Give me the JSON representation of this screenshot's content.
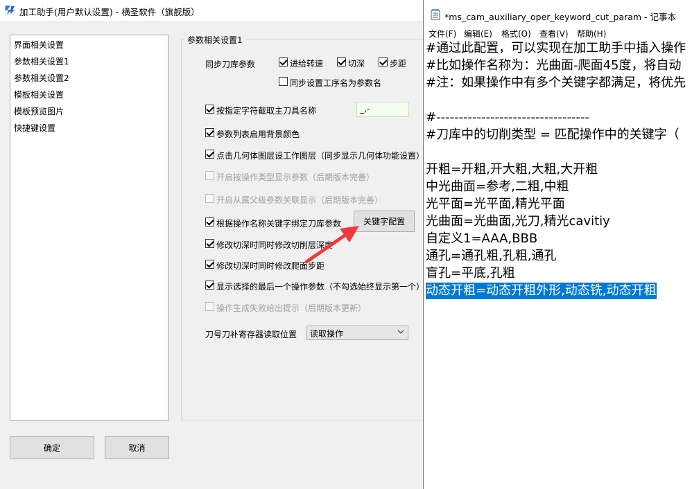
{
  "dialog": {
    "title": "加工助手(用户默认设置) - 横圣软件（旗舰版）",
    "nav_items": [
      "界面相关设置",
      "参数相关设置1",
      "参数相关设置2",
      "模板相关设置",
      "模板预览图片",
      "快捷键设置"
    ],
    "group_title": "参数相关设置1",
    "sync_label": "同步刀库参数",
    "sync_options": {
      "feed": "进给转速",
      "depth": "切深",
      "step": "步距",
      "sync_name": "同步设置工序名为参数名"
    },
    "options": {
      "cut_tool_name": "按指定字符截取主刀具名称",
      "cut_char": "_,-",
      "bg_color": "参数列表启用背景颜色",
      "geom_layer": "点击几何体图层设工作图层（同步显示几何体功能设置）",
      "by_type": "开启按操作类型显示参数（后期版本完善）",
      "parent_link": "开启从属父级参数关联显示（后期版本完善）",
      "bind_keyword": "根据操作名称关键字绑定刀库参数",
      "keyword_button": "关键字配置",
      "cut_depth": "修改切深时同时修改切削层深度",
      "climb_step": "修改切深时同时修改爬面步距",
      "show_last": "显示选择的最后一个操作参数（不勾选始终显示第一个）",
      "fail_prompt": "操作生成失败给出提示（后期版本更新）"
    },
    "register_label": "刀号刀补寄存器读取位置",
    "register_value": "读取操作",
    "ok_button": "确定",
    "cancel_button": "取消"
  },
  "notepad": {
    "title": "*ms_cam_auxiliary_oper_keyword_cut_param - 记事本",
    "menus": [
      "文件(F)",
      "编辑(E)",
      "格式(O)",
      "查看(V)",
      "帮助(H)"
    ],
    "lines": [
      "#通过此配置，可以实现在加工助手中插入操作",
      "#比如操作名称为：光曲面-爬面45度，将自动",
      "#注：如果操作中有多个关键字都满足，将优先",
      "",
      "#----------------------------------",
      "#刀库中的切削类型 = 匹配操作中的关键字（",
      "",
      "开粗=开粗,开大粗,大粗,大开粗",
      "中光曲面=参考,二粗,中粗",
      "光平面=光平面,精光平面",
      "光曲面=光曲面,光刀,精光cavitiy",
      "自定义1=AAA,BBB",
      "通孔=通孔粗,孔粗,通孔",
      "盲孔=平底,孔粗",
      "动态开粗=动态开粗外形,动态铣,动态开粗"
    ],
    "selected_line_index": 14
  },
  "colors": {
    "selection": "#0078d7",
    "arrow": "#f03a3a",
    "app_icon": "#2f7fd6"
  }
}
